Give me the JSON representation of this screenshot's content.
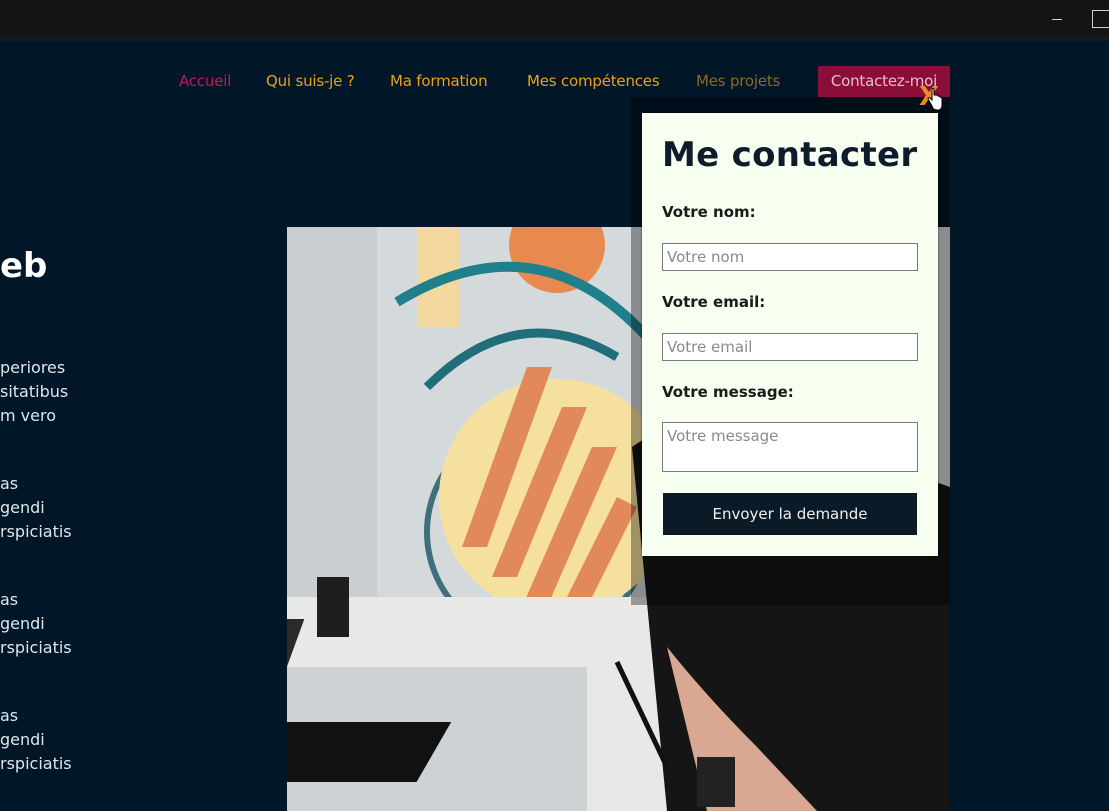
{
  "nav": {
    "items": [
      "Accueil",
      "Qui suis-je ?",
      "Ma formation",
      "Mes compétences",
      "Mes projets"
    ],
    "contact": "Contactez-moi"
  },
  "hero": {
    "title": "eb",
    "paragraphs": [
      "periores\nsitatibus\nm vero",
      "as\ngendi\nrspiciatis",
      "as\ngendi\nrspiciatis",
      "as\ngendi\nrspiciatis"
    ]
  },
  "modal": {
    "title": "Me contacter",
    "name_label": "Votre nom:",
    "name_placeholder": "Votre nom",
    "email_label": "Votre email:",
    "email_placeholder": "Votre email",
    "message_label": "Votre message:",
    "message_placeholder": "Votre message",
    "submit": "Envoyer la demande",
    "close": "X"
  },
  "colors": {
    "background": "#011627",
    "nav_link": "#e8a21e",
    "nav_active": "#c2185b",
    "contact_bg": "#8b0d3a",
    "modal_bg": "#f6fff0",
    "submit_bg": "#0a1a27",
    "close": "#f08a1c"
  },
  "icons": [
    "minimize-icon",
    "maximize-icon",
    "close-icon",
    "hand-cursor-icon"
  ]
}
